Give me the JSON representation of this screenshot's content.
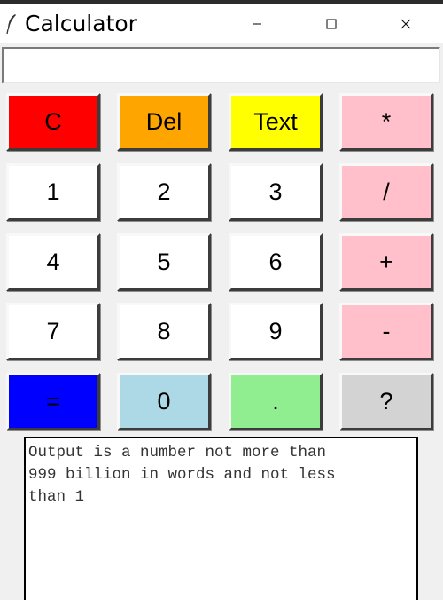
{
  "window": {
    "title": "Calculator",
    "controls": {
      "minimize": "─",
      "maximize": "☐",
      "close": "✕"
    }
  },
  "entry": {
    "value": ""
  },
  "keys": [
    [
      {
        "label": "C",
        "bg": "#ff0000"
      },
      {
        "label": "Del",
        "bg": "#ffa500"
      },
      {
        "label": "Text",
        "bg": "#ffff00"
      },
      {
        "label": "*",
        "bg": "#ffc0cb"
      }
    ],
    [
      {
        "label": "1",
        "bg": "#ffffff"
      },
      {
        "label": "2",
        "bg": "#ffffff"
      },
      {
        "label": "3",
        "bg": "#ffffff"
      },
      {
        "label": "/",
        "bg": "#ffc0cb"
      }
    ],
    [
      {
        "label": "4",
        "bg": "#ffffff"
      },
      {
        "label": "5",
        "bg": "#ffffff"
      },
      {
        "label": "6",
        "bg": "#ffffff"
      },
      {
        "label": "+",
        "bg": "#ffc0cb"
      }
    ],
    [
      {
        "label": "7",
        "bg": "#ffffff"
      },
      {
        "label": "8",
        "bg": "#ffffff"
      },
      {
        "label": "9",
        "bg": "#ffffff"
      },
      {
        "label": "-",
        "bg": "#ffc0cb"
      }
    ],
    [
      {
        "label": "=",
        "bg": "#0000ff"
      },
      {
        "label": "0",
        "bg": "#add8e6"
      },
      {
        "label": ".",
        "bg": "#90ee90"
      },
      {
        "label": "?",
        "bg": "#d3d3d3"
      }
    ]
  ],
  "output": {
    "text": "Output is a number not more than\n999 billion in words and not less\nthan 1"
  }
}
